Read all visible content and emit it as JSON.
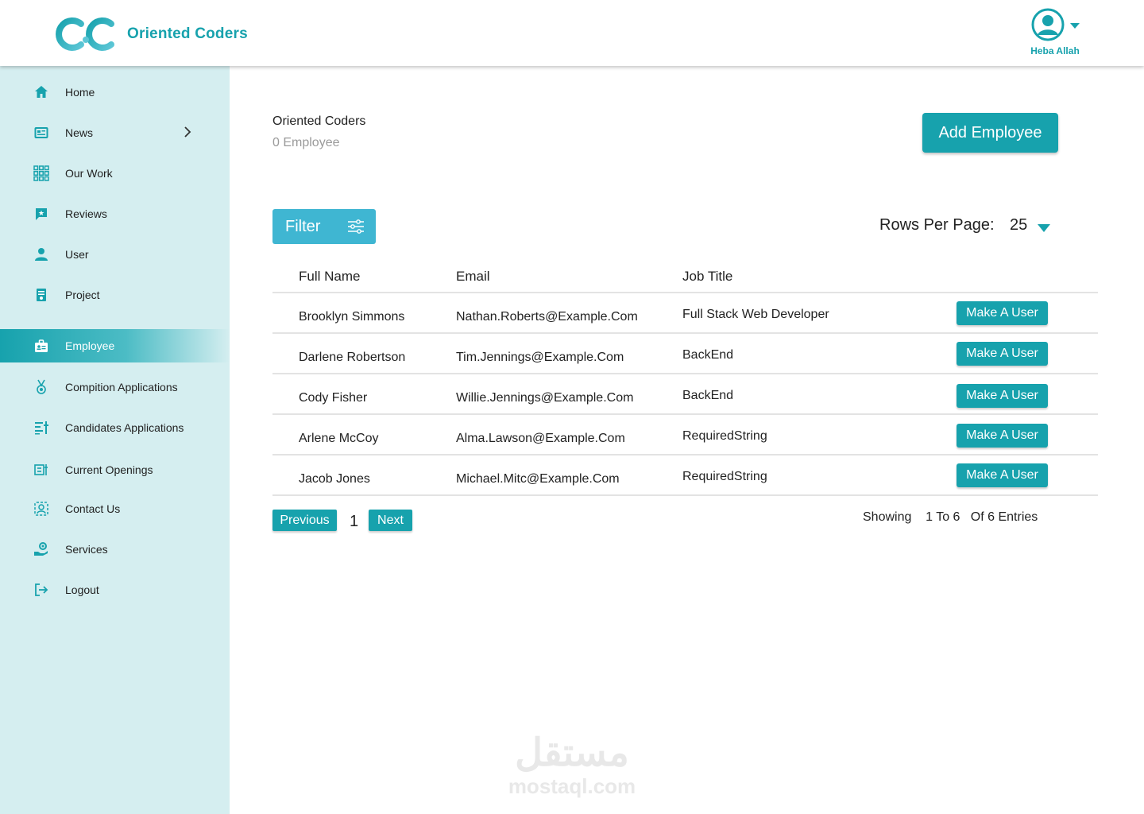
{
  "header": {
    "brand_name": "Oriented Coders",
    "brand_color": "#17a2ad",
    "user_name": "Heba Allah",
    "logo_icon": "oc-logo-icon",
    "avatar_icon": "user-circle-icon"
  },
  "sidebar": {
    "background": "#d5eef0",
    "items": [
      {
        "label": "Home",
        "icon": "home-icon"
      },
      {
        "label": "News",
        "icon": "newspaper-icon",
        "has_submenu": true
      },
      {
        "label": "Our Work",
        "icon": "grid-icon"
      },
      {
        "label": "Reviews",
        "icon": "review-icon"
      },
      {
        "label": "User",
        "icon": "person-icon"
      },
      {
        "label": "Project",
        "icon": "project-icon"
      },
      {
        "label": "Employee",
        "icon": "badge-icon",
        "active": true
      },
      {
        "label": "Compition Applications",
        "icon": "medal-icon"
      },
      {
        "label": "Candidates Applications",
        "icon": "list-applications-icon"
      },
      {
        "label": "Current Openings",
        "icon": "openings-icon"
      },
      {
        "label": "Contact Us",
        "icon": "contact-icon"
      },
      {
        "label": "Services",
        "icon": "services-icon"
      },
      {
        "label": "Logout",
        "icon": "logout-icon"
      }
    ]
  },
  "main": {
    "org_name": "Oriented Coders",
    "employee_count": "0 Employee",
    "add_button": "Add Employee",
    "filter_button": "Filter",
    "rows_per_page_label": "Rows Per Page:",
    "rows_per_page_value": "25",
    "table": {
      "columns": [
        "Full Name",
        "Email",
        "Job Title"
      ],
      "action_label": "Make A User",
      "rows": [
        {
          "name": "Brooklyn Simmons",
          "email": "Nathan.Roberts@Example.Com",
          "job": "Full Stack Web Developer"
        },
        {
          "name": "Darlene Robertson",
          "email": "Tim.Jennings@Example.Com",
          "job": "BackEnd"
        },
        {
          "name": "Cody Fisher",
          "email": "Willie.Jennings@Example.Com",
          "job": "BackEnd"
        },
        {
          "name": "Arlene McCoy",
          "email": "Alma.Lawson@Example.Com",
          "job": "RequiredString"
        },
        {
          "name": "Jacob Jones",
          "email": "Michael.Mitc@Example.Com",
          "job": "RequiredString"
        }
      ]
    },
    "pagination": {
      "previous": "Previous",
      "current_page": "1",
      "next": "Next",
      "showing": "Showing    1 To 6   Of 6 Entries"
    }
  },
  "watermark": {
    "arabic": "مستقل",
    "latin": "mostaql.com"
  }
}
